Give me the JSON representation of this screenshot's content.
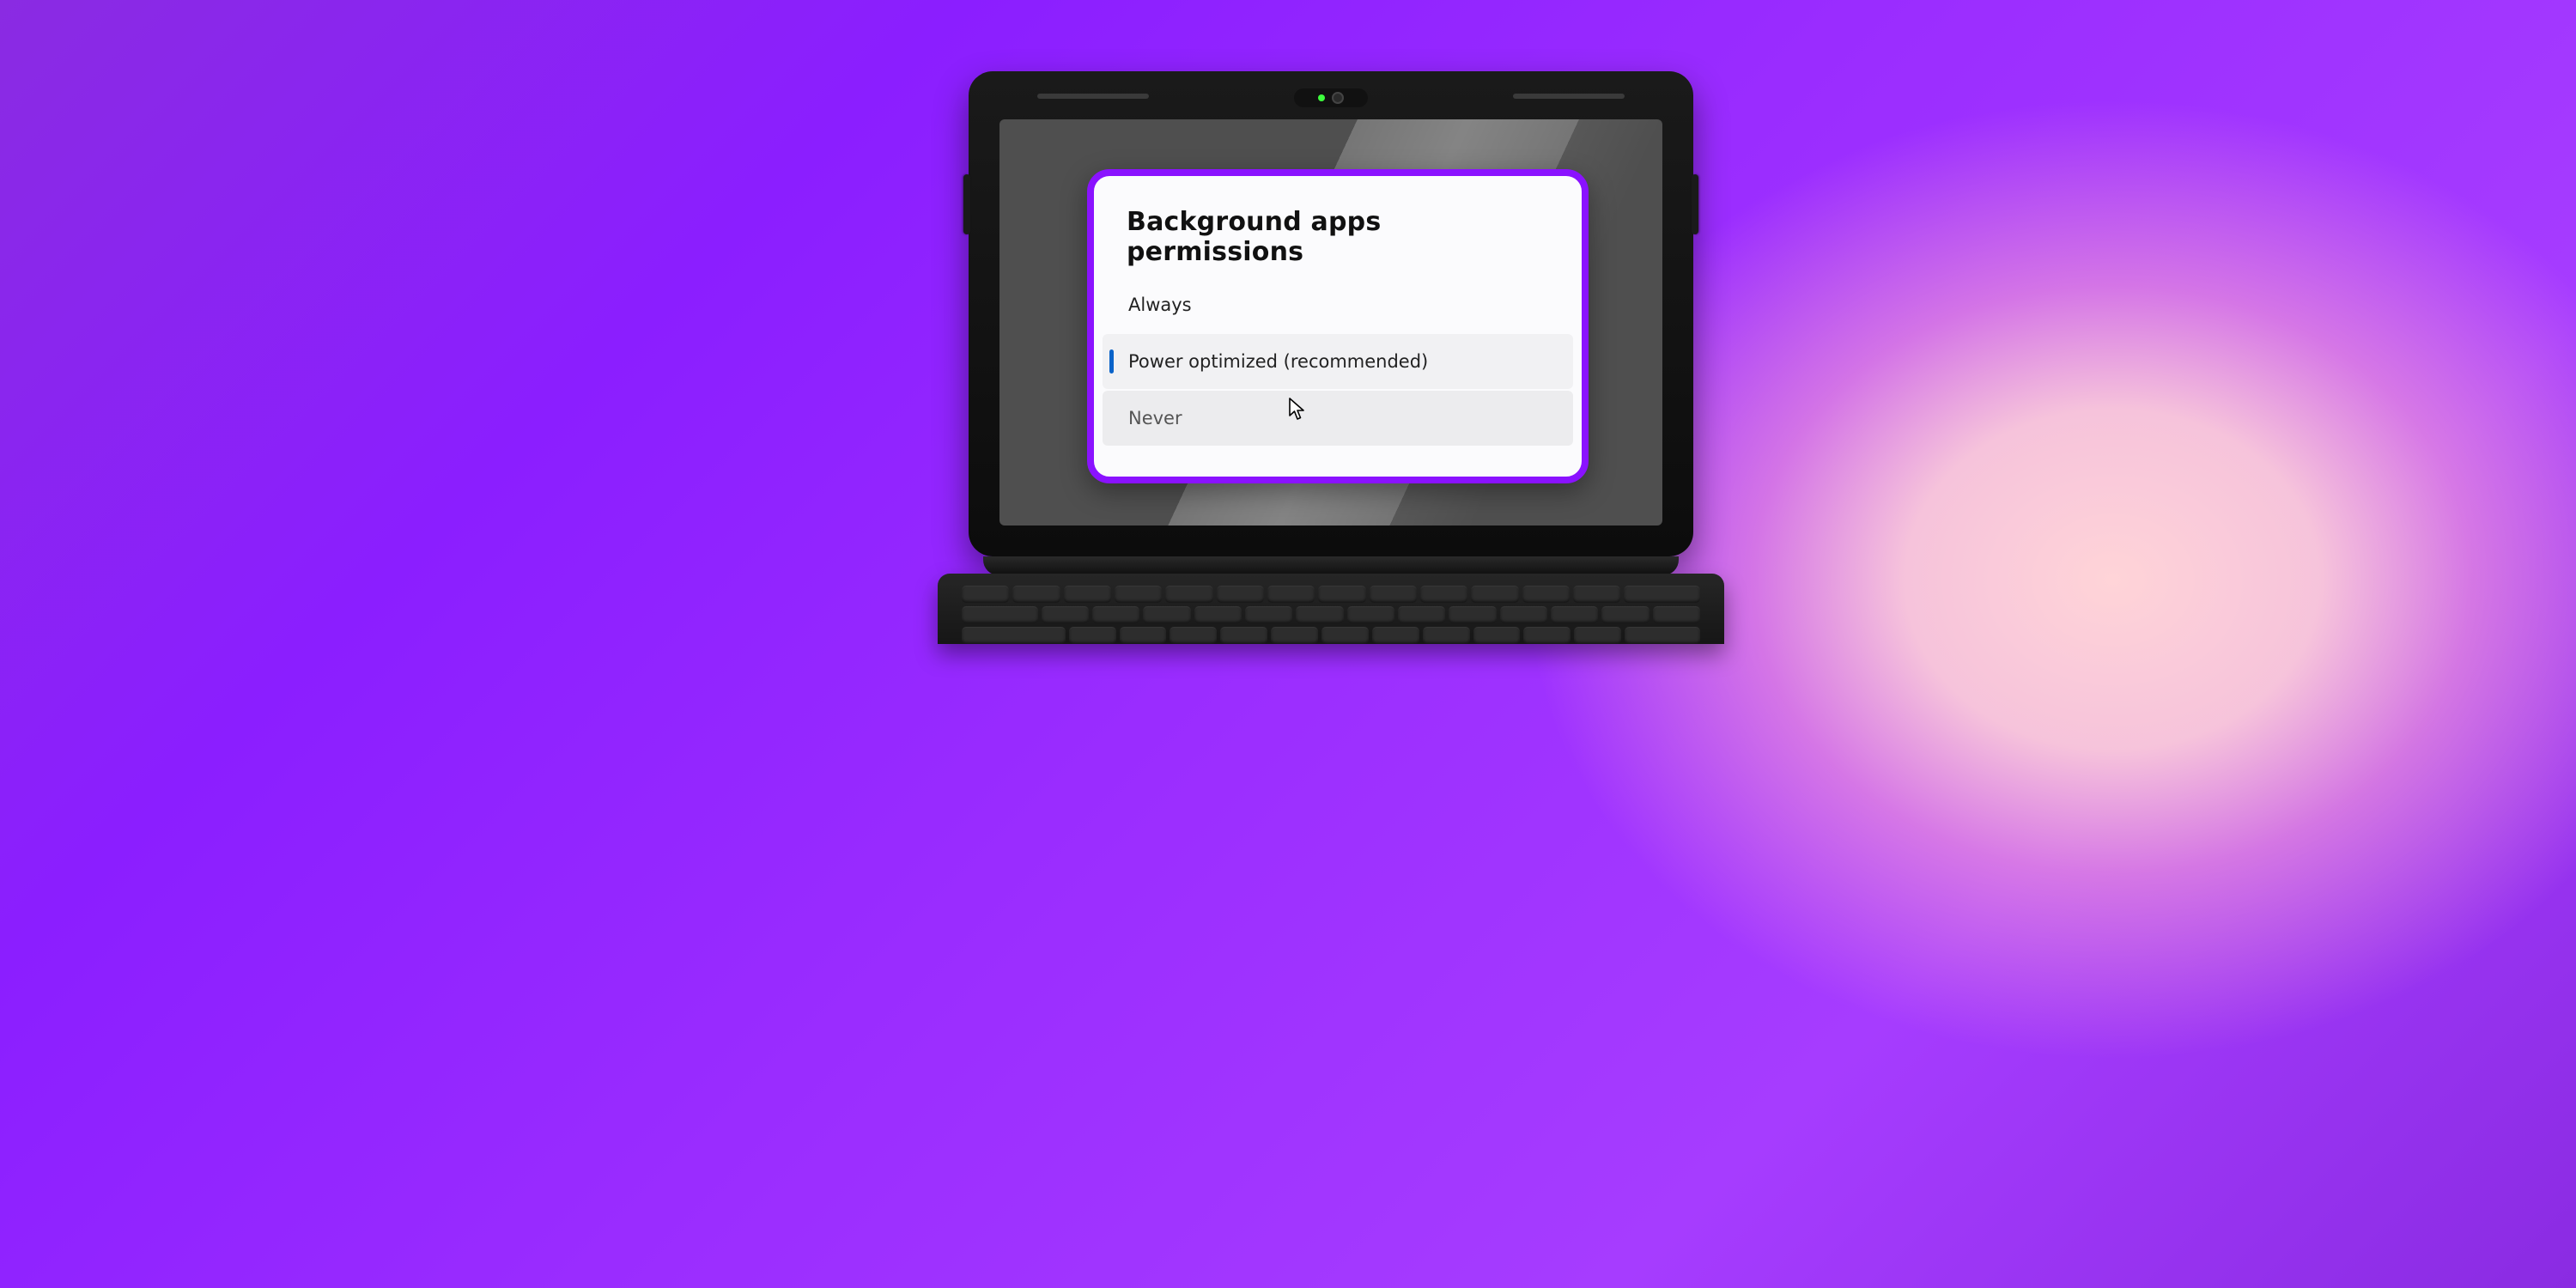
{
  "popup": {
    "title": "Background apps permissions",
    "options": [
      {
        "label": "Always",
        "selected": false,
        "hover": false
      },
      {
        "label": "Power optimized (recommended)",
        "selected": true,
        "hover": false
      },
      {
        "label": "Never",
        "selected": false,
        "hover": true
      }
    ]
  },
  "colors": {
    "popup_outline": "#8a12ff",
    "selection_bar": "#0a63c9"
  }
}
